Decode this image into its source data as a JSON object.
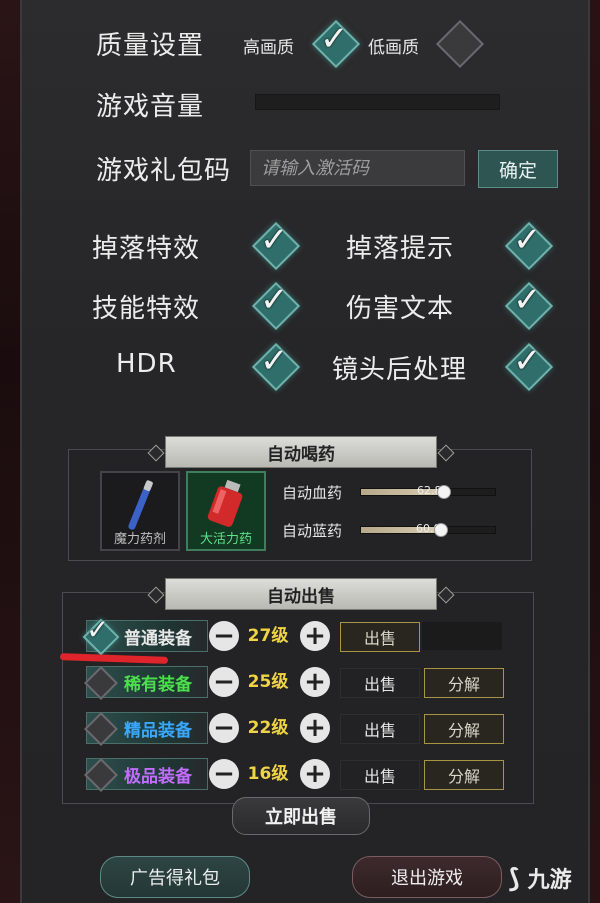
{
  "settings": {
    "quality": {
      "label": "质量设置",
      "high": "高画质",
      "low": "低画质",
      "selected": "高画质"
    },
    "volume": {
      "label": "游戏音量"
    },
    "gift_code": {
      "label": "游戏礼包码",
      "placeholder": "请输入激活码",
      "confirm": "确定"
    },
    "toggles": [
      {
        "label": "掉落特效",
        "checked": true
      },
      {
        "label": "掉落提示",
        "checked": true
      },
      {
        "label": "技能特效",
        "checked": true
      },
      {
        "label": "伤害文本",
        "checked": true
      },
      {
        "label": "HDR",
        "checked": true
      },
      {
        "label": "镜头后处理",
        "checked": true
      }
    ]
  },
  "auto_potion": {
    "title": "自动喝药",
    "potions": [
      {
        "name": "魔力药剂",
        "selected": false
      },
      {
        "name": "大活力药",
        "selected": true
      }
    ],
    "hp": {
      "label": "自动血药",
      "value": "62.8",
      "fraction": 0.62
    },
    "mp": {
      "label": "自动蓝药",
      "value": "60.0",
      "fraction": 0.6
    }
  },
  "auto_sell": {
    "title": "自动出售",
    "rows": [
      {
        "name": "普通装备",
        "color": "#e8e8e8",
        "checked": true,
        "level": "27级",
        "sell": "出售",
        "decompose": ""
      },
      {
        "name": "稀有装备",
        "color": "#4be04b",
        "checked": false,
        "level": "25级",
        "sell": "出售",
        "decompose": "分解"
      },
      {
        "name": "精品装备",
        "color": "#3aa7ff",
        "checked": false,
        "level": "22级",
        "sell": "出售",
        "decompose": "分解"
      },
      {
        "name": "极品装备",
        "color": "#c26cff",
        "checked": false,
        "level": "16级",
        "sell": "出售",
        "decompose": "分解"
      }
    ],
    "sell_now": "立即出售"
  },
  "bottom": {
    "ad_gift": "广告得礼包",
    "exit": "退出游戏"
  },
  "watermark": "九游",
  "colors": {
    "accent_teal": "#2f6e6a",
    "level_yellow": "#f0d447",
    "annotation_red": "#e0242c"
  }
}
